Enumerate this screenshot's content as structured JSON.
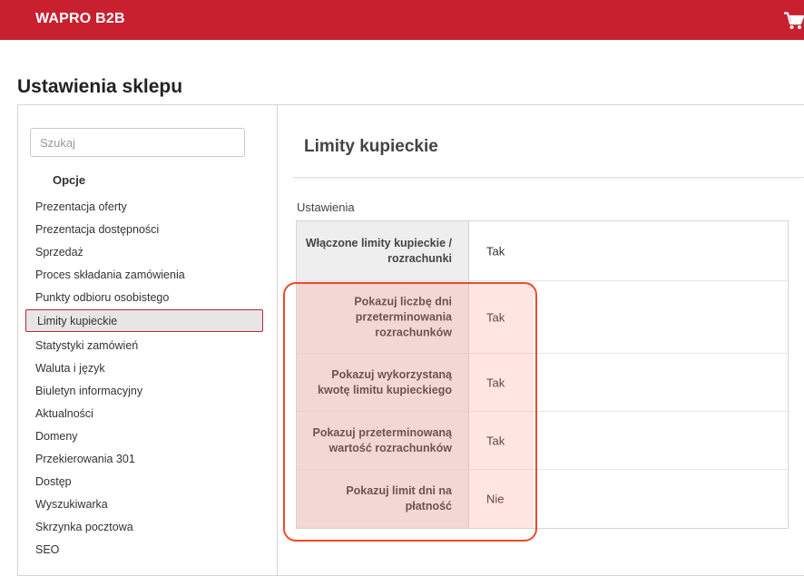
{
  "header": {
    "brand": "WAPRO B2B",
    "cart_icon": "shopping-cart-icon",
    "background_color": "#c8202f"
  },
  "page_title": "Ustawienia sklepu",
  "sidebar": {
    "search": {
      "placeholder": "Szukaj",
      "value": ""
    },
    "section_label": "Opcje",
    "items": [
      {
        "label": "Prezentacja oferty"
      },
      {
        "label": "Prezentacja dostępności"
      },
      {
        "label": "Sprzedaż"
      },
      {
        "label": "Proces składania zamówienia"
      },
      {
        "label": "Punkty odbioru osobistego"
      },
      {
        "label": "Limity kupieckie",
        "active": true
      },
      {
        "label": "Statystyki zamówień"
      },
      {
        "label": "Waluta i język"
      },
      {
        "label": "Biuletyn informacyjny"
      },
      {
        "label": "Aktualności"
      },
      {
        "label": "Domeny"
      },
      {
        "label": "Przekierowania 301"
      },
      {
        "label": "Dostęp"
      },
      {
        "label": "Wyszukiwarka"
      },
      {
        "label": "Skrzynka pocztowa"
      },
      {
        "label": "SEO"
      }
    ]
  },
  "main": {
    "section_title": "Limity kupieckie",
    "settings_label": "Ustawienia",
    "rows": [
      {
        "label": "Włączone limity kupieckie / rozrachunki",
        "value": "Tak"
      },
      {
        "label": "Pokazuj liczbę dni przeterminowania rozrachunków",
        "value": "Tak"
      },
      {
        "label": "Pokazuj wykorzystaną kwotę limitu kupieckiego",
        "value": "Tak"
      },
      {
        "label": "Pokazuj przeterminowaną wartość rozrachunków",
        "value": "Tak"
      },
      {
        "label": "Pokazuj limit dni na płatność",
        "value": "Nie"
      }
    ]
  },
  "colors": {
    "accent": "#c8202f",
    "highlight_border": "#ee4a2a"
  }
}
